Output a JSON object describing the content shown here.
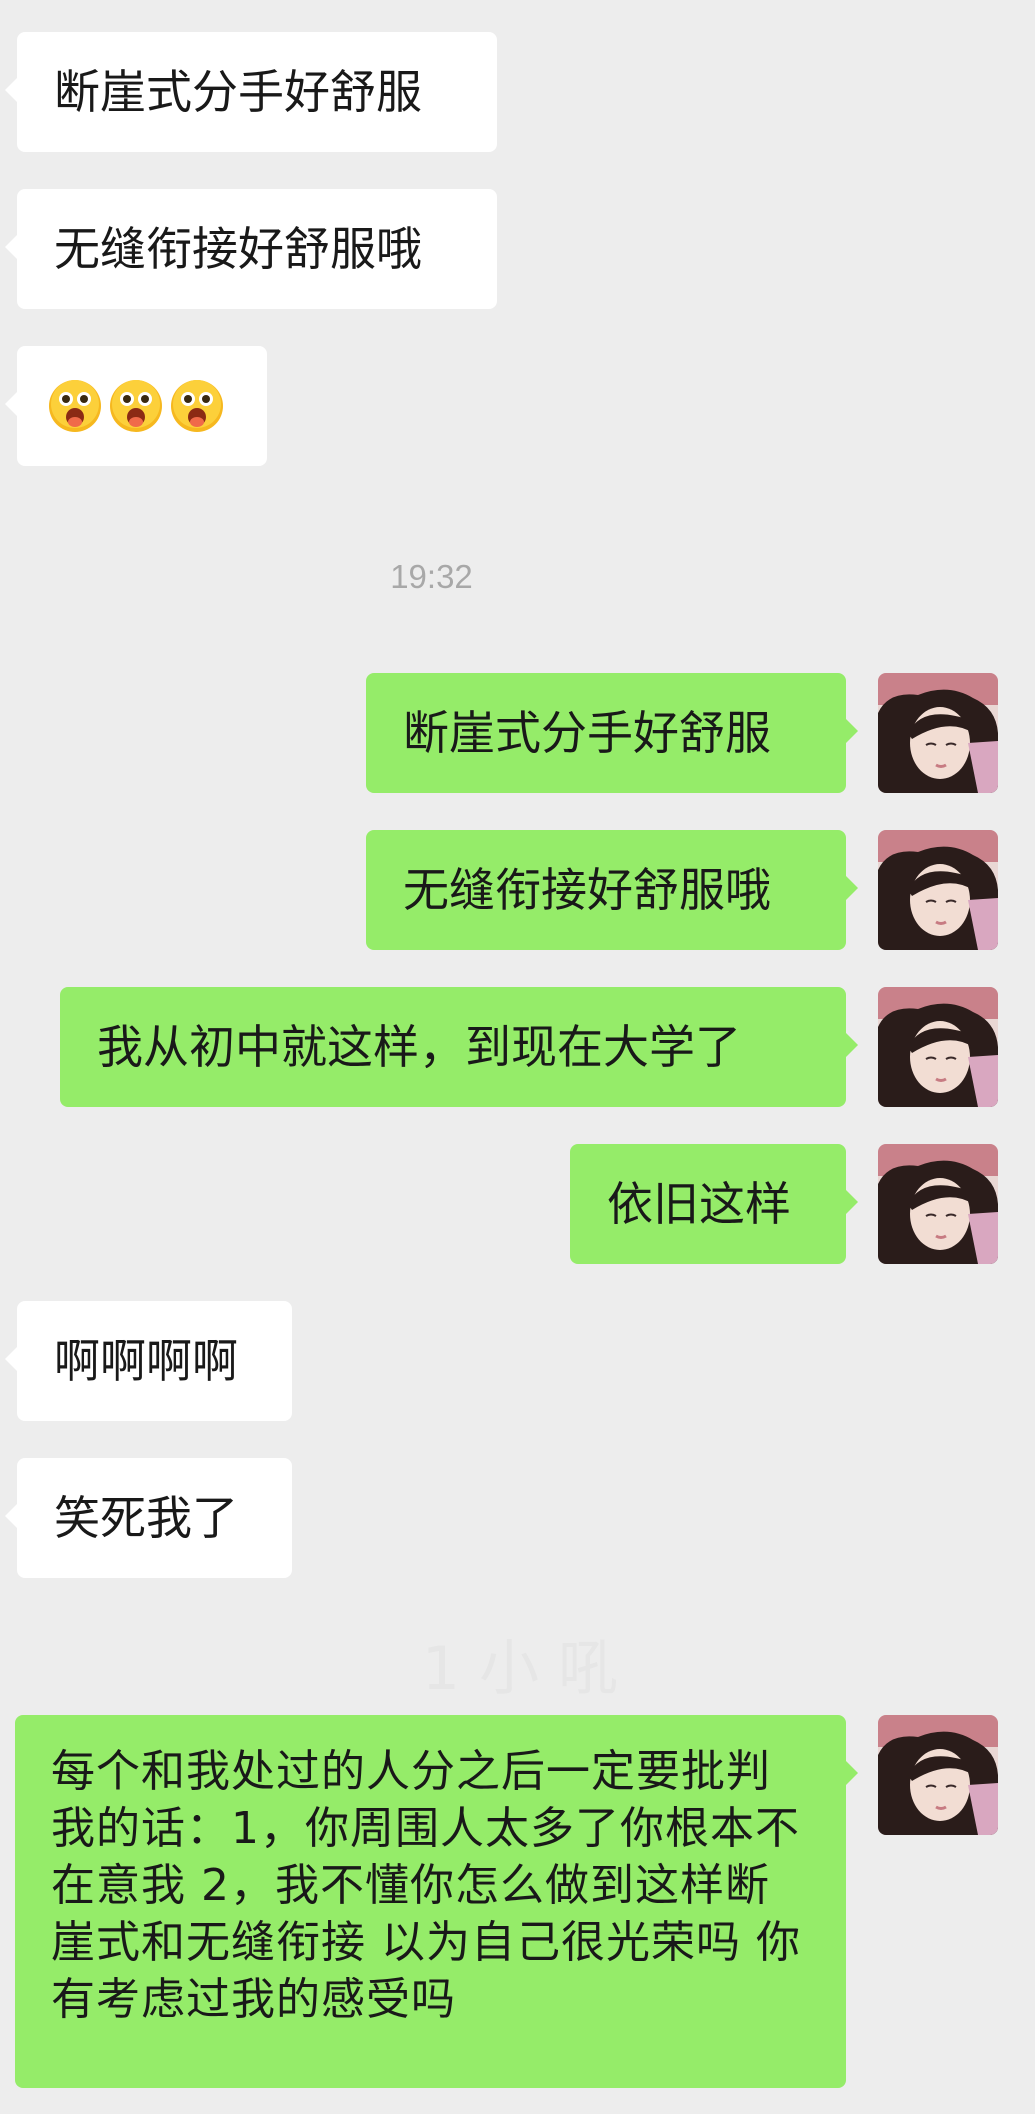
{
  "messages": [
    {
      "side": "in",
      "text": "断崖式分手好舒服"
    },
    {
      "side": "in",
      "text": "无缝衔接好舒服哦"
    },
    {
      "side": "in",
      "emoji": [
        "astonished-tongue-face-emoji",
        "astonished-tongue-face-emoji",
        "astonished-tongue-face-emoji"
      ]
    },
    {
      "side": "out",
      "text": "断崖式分手好舒服"
    },
    {
      "side": "out",
      "text": "无缝衔接好舒服哦"
    },
    {
      "side": "out",
      "text": "我从初中就这样，到现在大学了"
    },
    {
      "side": "out",
      "text": "依旧这样"
    },
    {
      "side": "in",
      "text": "啊啊啊啊"
    },
    {
      "side": "in",
      "text": "笑死我了"
    },
    {
      "side": "out",
      "text": "每个和我处过的人分之后一定要批判我的话：1，你周围人太多了你根本不在意我 2，我不懂你怎么做到这样断崖式和无缝衔接 以为自己很光荣吗 你有考虑过我的感受吗"
    }
  ],
  "timestamp": "19:32",
  "watermark": "1 小 吼",
  "colors": {
    "background": "#ededed",
    "incoming_bubble": "#ffffff",
    "outgoing_bubble": "#95ec69",
    "text": "#191919",
    "timestamp": "#a8a8a8"
  }
}
